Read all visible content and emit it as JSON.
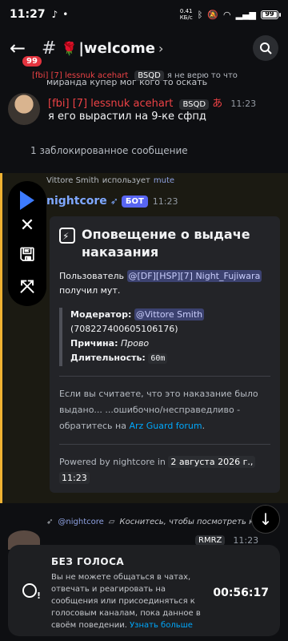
{
  "status": {
    "time": "11:27",
    "speed": "0.41\nКБ/с",
    "battery": "99"
  },
  "header": {
    "badge_count": "99",
    "channel_emoji": "🌹",
    "channel_name": "|welcome"
  },
  "reply_preview": {
    "author": "[fbi] [7] lessnuk acehart",
    "tag": "BSQD",
    "text_line1": "я не верю то что",
    "text_line2": "миранда купер мог кого то оскать"
  },
  "message1": {
    "author": "[fbi] [7] lessnuk acehart",
    "tag": "BSQD",
    "extra_emoji": "あ",
    "time": "11:23",
    "text": "я его вырастил на 9-ке сфпд"
  },
  "blocked_text": "1 заблокированное сообщение",
  "system_line": {
    "user": "Vittore Smith",
    "action": "использует",
    "command": "mute"
  },
  "bot": {
    "name": "nightcore",
    "badge": "БОТ",
    "time": "11:23"
  },
  "embed": {
    "title": "Оповещение о выдаче наказания",
    "user_prefix": "Пользователь",
    "user_mention": "@[DF][HSP][7] Night_Fujiwara",
    "user_suffix": "получил мут.",
    "moderator_label": "Модератор:",
    "moderator_mention": "@Vittore Smith",
    "moderator_id": "(708227400605106176)",
    "reason_label": "Причина:",
    "reason_value": "Прово",
    "duration_label": "Длительность:",
    "duration_value": "60m",
    "appeal_text": "Если вы считаете, что это наказание было выдано... ...ошибочно/несправедливо - обратитесь на",
    "appeal_link": "Arz Guard forum",
    "footer_prefix": "Powered by nightcore in",
    "footer_date": "2 августа 2026 г.,",
    "footer_time": "11:23"
  },
  "reply2": {
    "name": "@nightcore",
    "text": "Коснитесь, чтобы посмотреть ко"
  },
  "partial_tag": "RMRZ",
  "partial_time": "11:23",
  "timeout": {
    "title": "БЕЗ ГОЛОСА",
    "body": "Вы не можете общаться в чатах, отвечать и реагировать на сообщения или присоединяться к голосовым каналам, пока данное в своём поведении.",
    "more": "Узнать больше",
    "countdown": "00:56:17"
  },
  "icons": {
    "back": "arrow-left-icon",
    "search": "search-icon",
    "play": "play-icon",
    "close": "close-icon",
    "save": "save-icon",
    "fullscreen": "expand-icon",
    "scroll_down": "arrow-down-icon"
  },
  "colors": {
    "accent_red": "#ed4245",
    "bot_blue": "#7fa8ff",
    "blurple": "#5865f2",
    "highlight": "#f0b232",
    "link": "#00a8fc"
  }
}
